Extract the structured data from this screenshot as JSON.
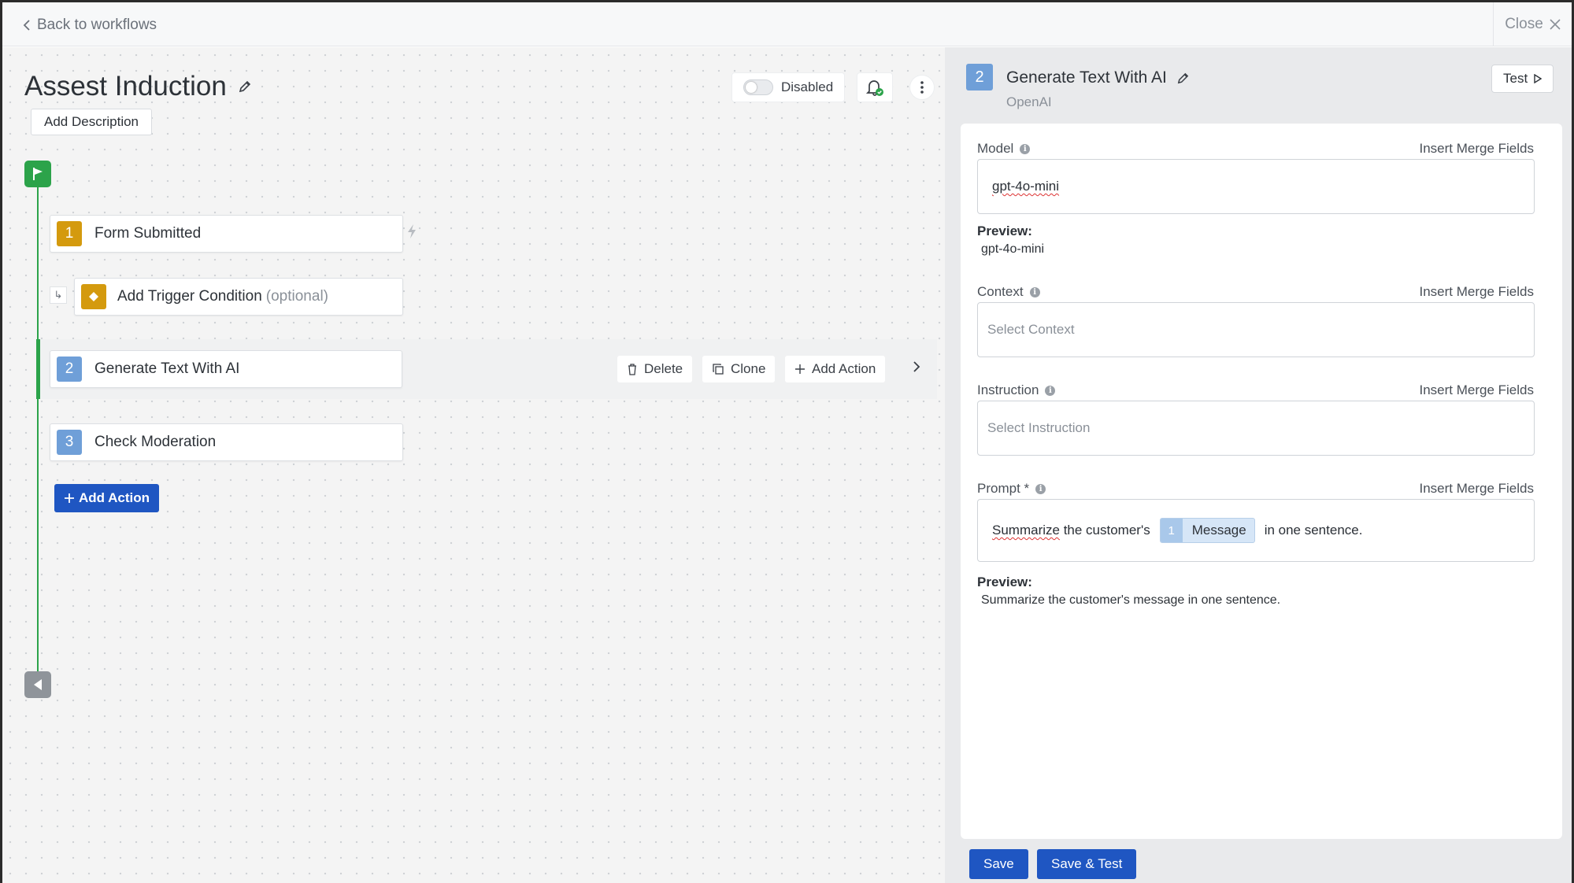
{
  "topbar": {
    "back_label": "Back to workflows",
    "close_label": "Close"
  },
  "workflow": {
    "title": "Assest Induction",
    "add_description": "Add Description",
    "toggle_label": "Disabled"
  },
  "nodes": [
    {
      "num": "1",
      "label": "Form Submitted",
      "color": "#d49a0e"
    },
    {
      "label": "Add Trigger Condition",
      "optional": "(optional)",
      "color": "#d49a0e"
    },
    {
      "num": "2",
      "label": "Generate Text With AI",
      "color": "#6f9fd8"
    },
    {
      "num": "3",
      "label": "Check Moderation",
      "color": "#6f9fd8"
    }
  ],
  "row_actions": {
    "delete": "Delete",
    "clone": "Clone",
    "add_action": "Add Action"
  },
  "add_action_button": "Add Action",
  "panel": {
    "step_num": "2",
    "title": "Generate Text With AI",
    "subtitle": "OpenAI",
    "test_label": "Test",
    "insert_merge": "Insert Merge Fields",
    "model": {
      "label": "Model",
      "value": "gpt-4o-mini",
      "preview_label": "Preview:",
      "preview_value": "gpt-4o-mini"
    },
    "context": {
      "label": "Context",
      "placeholder": "Select Context"
    },
    "instruction": {
      "label": "Instruction",
      "placeholder": "Select Instruction"
    },
    "prompt": {
      "label": "Prompt *",
      "text_first_word": "Summarize",
      "text_before": " the customer's",
      "chip_num": "1",
      "chip_label": "Message",
      "text_after": "in one sentence.",
      "preview_label": "Preview:",
      "preview_value": "Summarize the customer's message in one sentence."
    },
    "save_label": "Save",
    "save_test_label": "Save & Test"
  },
  "colors": {
    "accent": "#1f56c2",
    "flow_green": "#2ca34a",
    "gold": "#d49a0e",
    "step_blue": "#6f9fd8"
  }
}
